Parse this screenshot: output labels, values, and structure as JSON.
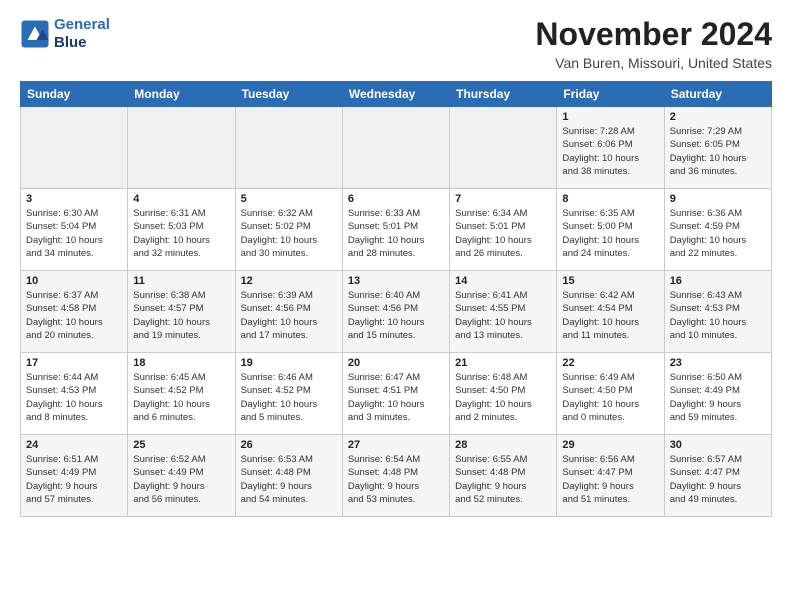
{
  "header": {
    "logo_line1": "General",
    "logo_line2": "Blue",
    "title": "November 2024",
    "location": "Van Buren, Missouri, United States"
  },
  "weekdays": [
    "Sunday",
    "Monday",
    "Tuesday",
    "Wednesday",
    "Thursday",
    "Friday",
    "Saturday"
  ],
  "weeks": [
    [
      {
        "day": "",
        "info": ""
      },
      {
        "day": "",
        "info": ""
      },
      {
        "day": "",
        "info": ""
      },
      {
        "day": "",
        "info": ""
      },
      {
        "day": "",
        "info": ""
      },
      {
        "day": "1",
        "info": "Sunrise: 7:28 AM\nSunset: 6:06 PM\nDaylight: 10 hours\nand 38 minutes."
      },
      {
        "day": "2",
        "info": "Sunrise: 7:29 AM\nSunset: 6:05 PM\nDaylight: 10 hours\nand 36 minutes."
      }
    ],
    [
      {
        "day": "3",
        "info": "Sunrise: 6:30 AM\nSunset: 5:04 PM\nDaylight: 10 hours\nand 34 minutes."
      },
      {
        "day": "4",
        "info": "Sunrise: 6:31 AM\nSunset: 5:03 PM\nDaylight: 10 hours\nand 32 minutes."
      },
      {
        "day": "5",
        "info": "Sunrise: 6:32 AM\nSunset: 5:02 PM\nDaylight: 10 hours\nand 30 minutes."
      },
      {
        "day": "6",
        "info": "Sunrise: 6:33 AM\nSunset: 5:01 PM\nDaylight: 10 hours\nand 28 minutes."
      },
      {
        "day": "7",
        "info": "Sunrise: 6:34 AM\nSunset: 5:01 PM\nDaylight: 10 hours\nand 26 minutes."
      },
      {
        "day": "8",
        "info": "Sunrise: 6:35 AM\nSunset: 5:00 PM\nDaylight: 10 hours\nand 24 minutes."
      },
      {
        "day": "9",
        "info": "Sunrise: 6:36 AM\nSunset: 4:59 PM\nDaylight: 10 hours\nand 22 minutes."
      }
    ],
    [
      {
        "day": "10",
        "info": "Sunrise: 6:37 AM\nSunset: 4:58 PM\nDaylight: 10 hours\nand 20 minutes."
      },
      {
        "day": "11",
        "info": "Sunrise: 6:38 AM\nSunset: 4:57 PM\nDaylight: 10 hours\nand 19 minutes."
      },
      {
        "day": "12",
        "info": "Sunrise: 6:39 AM\nSunset: 4:56 PM\nDaylight: 10 hours\nand 17 minutes."
      },
      {
        "day": "13",
        "info": "Sunrise: 6:40 AM\nSunset: 4:56 PM\nDaylight: 10 hours\nand 15 minutes."
      },
      {
        "day": "14",
        "info": "Sunrise: 6:41 AM\nSunset: 4:55 PM\nDaylight: 10 hours\nand 13 minutes."
      },
      {
        "day": "15",
        "info": "Sunrise: 6:42 AM\nSunset: 4:54 PM\nDaylight: 10 hours\nand 11 minutes."
      },
      {
        "day": "16",
        "info": "Sunrise: 6:43 AM\nSunset: 4:53 PM\nDaylight: 10 hours\nand 10 minutes."
      }
    ],
    [
      {
        "day": "17",
        "info": "Sunrise: 6:44 AM\nSunset: 4:53 PM\nDaylight: 10 hours\nand 8 minutes."
      },
      {
        "day": "18",
        "info": "Sunrise: 6:45 AM\nSunset: 4:52 PM\nDaylight: 10 hours\nand 6 minutes."
      },
      {
        "day": "19",
        "info": "Sunrise: 6:46 AM\nSunset: 4:52 PM\nDaylight: 10 hours\nand 5 minutes."
      },
      {
        "day": "20",
        "info": "Sunrise: 6:47 AM\nSunset: 4:51 PM\nDaylight: 10 hours\nand 3 minutes."
      },
      {
        "day": "21",
        "info": "Sunrise: 6:48 AM\nSunset: 4:50 PM\nDaylight: 10 hours\nand 2 minutes."
      },
      {
        "day": "22",
        "info": "Sunrise: 6:49 AM\nSunset: 4:50 PM\nDaylight: 10 hours\nand 0 minutes."
      },
      {
        "day": "23",
        "info": "Sunrise: 6:50 AM\nSunset: 4:49 PM\nDaylight: 9 hours\nand 59 minutes."
      }
    ],
    [
      {
        "day": "24",
        "info": "Sunrise: 6:51 AM\nSunset: 4:49 PM\nDaylight: 9 hours\nand 57 minutes."
      },
      {
        "day": "25",
        "info": "Sunrise: 6:52 AM\nSunset: 4:49 PM\nDaylight: 9 hours\nand 56 minutes."
      },
      {
        "day": "26",
        "info": "Sunrise: 6:53 AM\nSunset: 4:48 PM\nDaylight: 9 hours\nand 54 minutes."
      },
      {
        "day": "27",
        "info": "Sunrise: 6:54 AM\nSunset: 4:48 PM\nDaylight: 9 hours\nand 53 minutes."
      },
      {
        "day": "28",
        "info": "Sunrise: 6:55 AM\nSunset: 4:48 PM\nDaylight: 9 hours\nand 52 minutes."
      },
      {
        "day": "29",
        "info": "Sunrise: 6:56 AM\nSunset: 4:47 PM\nDaylight: 9 hours\nand 51 minutes."
      },
      {
        "day": "30",
        "info": "Sunrise: 6:57 AM\nSunset: 4:47 PM\nDaylight: 9 hours\nand 49 minutes."
      }
    ]
  ]
}
